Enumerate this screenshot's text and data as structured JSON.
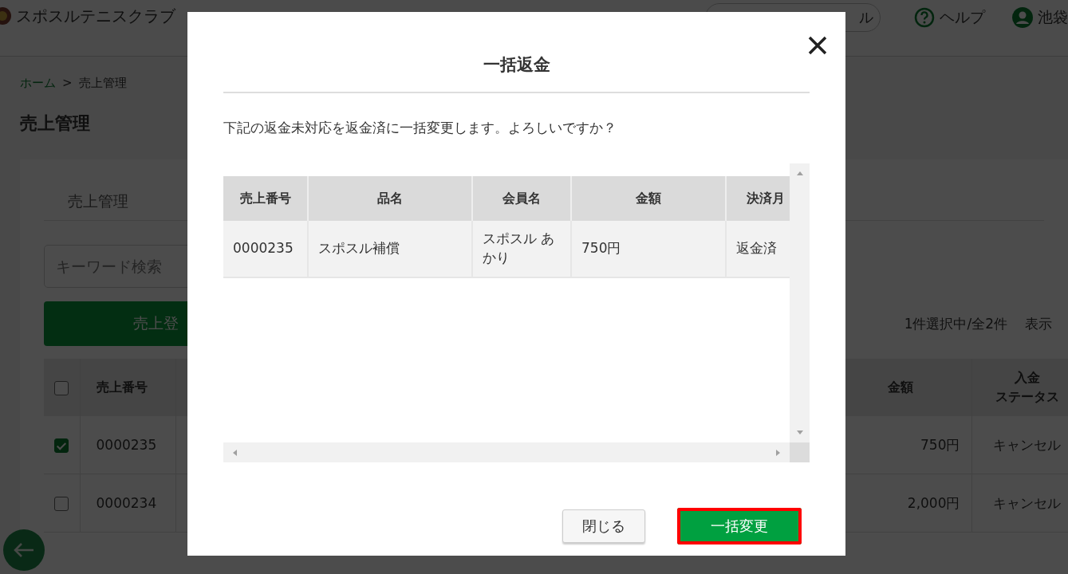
{
  "header": {
    "site_name": "スポスルテニスクラブ",
    "manual_button_fragment": "ル",
    "help": "ヘルプ",
    "user": "池袋"
  },
  "breadcrumb": [
    {
      "label": "ホーム",
      "kind": "link"
    },
    {
      "label": "売上管理",
      "kind": "current"
    }
  ],
  "breadcrumb_separator": ">",
  "page_title": "売上管理",
  "tabs": [
    "売上管理"
  ],
  "search": {
    "placeholder": "キーワード検索"
  },
  "register_button": "売上登",
  "selection_count": "1件選択中/全2件",
  "display_label": "表示",
  "sales_table": {
    "select_all_checked": false,
    "columns": [
      "売上番号",
      "金額",
      "入金ステータス"
    ],
    "rows": [
      {
        "checked": true,
        "cells": [
          "0000235",
          "750円",
          "キャンセル"
        ]
      },
      {
        "checked": false,
        "cells": [
          "0000234",
          "2,000円",
          "キャンセル"
        ]
      }
    ]
  },
  "dialog": {
    "title": "一括返金",
    "message": "下記の返金未対応を返金済に一括変更します。よろしいですか？",
    "table": {
      "columns": [
        "売上番号",
        "品名",
        "会員名",
        "金額",
        "決済月"
      ],
      "rows": [
        [
          "0000235",
          "スポスル補償",
          "スポスル あかり",
          "750円",
          "返金済"
        ]
      ]
    },
    "buttons": [
      {
        "label": "閉じる",
        "kind": "secondary",
        "focused": false
      },
      {
        "label": "一括変更",
        "kind": "primary",
        "focused": true
      }
    ]
  }
}
